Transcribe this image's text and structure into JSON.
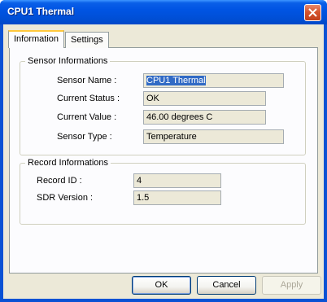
{
  "window": {
    "title": "CPU1 Thermal"
  },
  "tabs": [
    {
      "label": "Information",
      "active": true
    },
    {
      "label": "Settings",
      "active": false
    }
  ],
  "sensor_group": {
    "legend": "Sensor Informations",
    "rows": [
      {
        "label": "Sensor Name :",
        "value": "CPU1 Thermal"
      },
      {
        "label": "Current Status :",
        "value": "OK"
      },
      {
        "label": "Current Value :",
        "value": "46.00 degrees C"
      },
      {
        "label": "Sensor Type  :",
        "value": "Temperature"
      }
    ]
  },
  "record_group": {
    "legend": "Record Informations",
    "rows": [
      {
        "label": "Record ID   :",
        "value": "4"
      },
      {
        "label": "SDR Version :",
        "value": "1.5"
      }
    ]
  },
  "buttons": {
    "ok": "OK",
    "cancel": "Cancel",
    "apply": "Apply"
  },
  "colors": {
    "titlebar": "#0054e3",
    "close": "#d6552f",
    "face": "#ece9d8",
    "selection": "#316ac5"
  }
}
